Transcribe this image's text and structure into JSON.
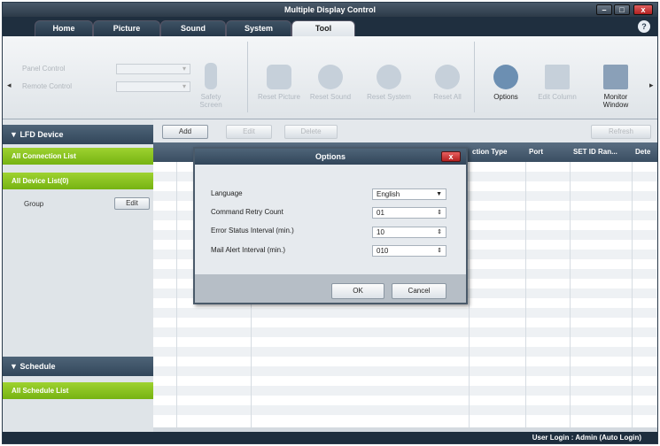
{
  "window": {
    "title": "Multiple Display Control",
    "minimize": "–",
    "maximize": "□",
    "close": "x"
  },
  "tabs": [
    {
      "label": "Home"
    },
    {
      "label": "Picture"
    },
    {
      "label": "Sound"
    },
    {
      "label": "System"
    },
    {
      "label": "Tool",
      "active": true
    }
  ],
  "help": "?",
  "ribbon": {
    "panel_control": "Panel Control",
    "remote_control": "Remote Control",
    "buttons": [
      "Safety Screen",
      "Reset Picture",
      "Reset Sound",
      "Reset System",
      "Reset All",
      "Options",
      "Edit Column",
      "Monitor Window"
    ],
    "left_arrow": "◂",
    "right_arrow": "▸"
  },
  "sidebar": {
    "lfd_header": "LFD Device",
    "all_connection_list": "All Connection List",
    "all_device_list": "All Device List(0)",
    "group_label": "Group",
    "group_edit": "Edit",
    "schedule_header": "Schedule",
    "all_schedule_list": "All Schedule List",
    "collapse_glyph": "▼"
  },
  "toolbar": {
    "add": "Add",
    "edit": "Edit",
    "delete": "Delete",
    "refresh": "Refresh"
  },
  "grid": {
    "columns": [
      "",
      "",
      "",
      "ction Type",
      "Port",
      "SET ID Ran...",
      "Dete"
    ]
  },
  "status": {
    "text": "User Login : Admin (Auto Login)"
  },
  "options_dialog": {
    "title": "Options",
    "close": "x",
    "fields": [
      {
        "label": "Language",
        "value": "English",
        "control": "dropdown",
        "arrow": "▼"
      },
      {
        "label": "Command Retry Count",
        "value": "01",
        "control": "spinner",
        "arrow": "⇕"
      },
      {
        "label": "Error Status Interval (min.)",
        "value": "10",
        "control": "spinner",
        "arrow": "⇕"
      },
      {
        "label": "Mail Alert Interval (min.)",
        "value": "010",
        "control": "spinner",
        "arrow": "⇕"
      }
    ],
    "ok": "OK",
    "cancel": "Cancel"
  }
}
